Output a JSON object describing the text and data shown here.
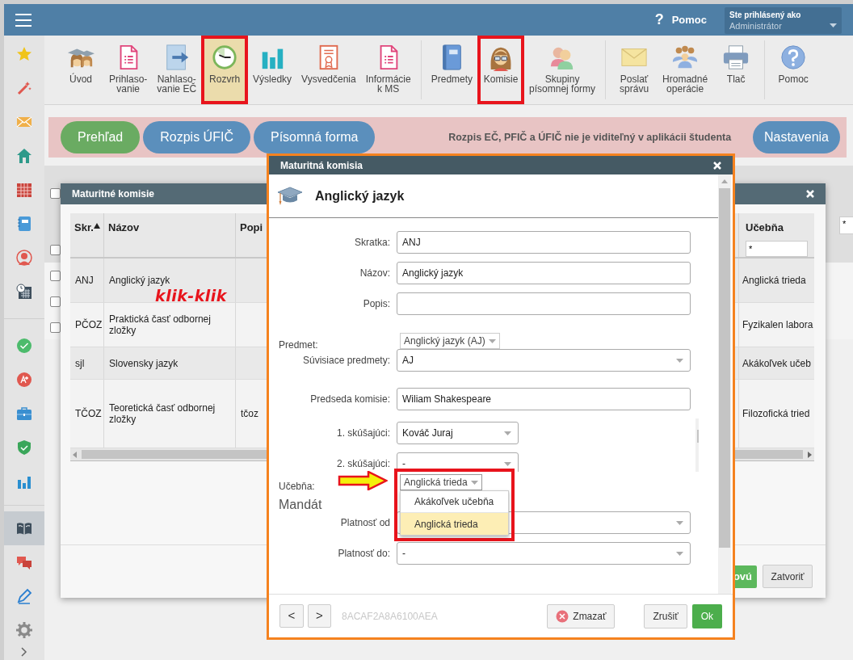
{
  "top_bar": {
    "help_mark": "?",
    "help_label": "Pomoc",
    "user": {
      "caption": "Ste prihlásený ako",
      "name": "Administrátor"
    }
  },
  "sidebar": {
    "groups": [
      [
        {
          "selected": false
        },
        {
          "selected": false
        },
        {
          "selected": false
        },
        {
          "selected": false
        },
        {
          "selected": false
        },
        {
          "selected": false
        },
        {
          "selected": false
        },
        {
          "selected": false
        }
      ],
      [
        {
          "selected": false
        },
        {
          "selected": false
        },
        {
          "selected": false
        },
        {
          "selected": false
        },
        {
          "selected": false
        }
      ],
      [
        {
          "selected": true
        },
        {
          "selected": false
        },
        {
          "selected": false
        },
        {
          "selected": false
        }
      ]
    ]
  },
  "toolbar": {
    "groups": [
      [
        {
          "label": "Úvod",
          "selected": false,
          "highlighted": false
        },
        {
          "label": "Prihlaso-\nvanie",
          "selected": false,
          "highlighted": false
        },
        {
          "label": "Nahlaso-\nvanie EČ",
          "selected": false,
          "highlighted": false
        },
        {
          "label": "Rozvrh",
          "selected": true,
          "highlighted": true
        },
        {
          "label": "Výsledky",
          "selected": false,
          "highlighted": false
        },
        {
          "label": "Vysvedčenia",
          "selected": false,
          "highlighted": false
        },
        {
          "label": "Informácie\nk MS",
          "selected": false,
          "highlighted": false
        }
      ],
      [
        {
          "label": "Predmety",
          "selected": false,
          "highlighted": false
        },
        {
          "label": "Komisie",
          "selected": false,
          "highlighted": true
        },
        {
          "label": "Skupiny\npísomnej formy",
          "selected": false,
          "highlighted": false
        }
      ],
      [
        {
          "label": "Poslať\nsprávu",
          "selected": false,
          "highlighted": false
        },
        {
          "label": "Hromadné\noperácie",
          "selected": false,
          "highlighted": false
        },
        {
          "label": "Tlač",
          "selected": false,
          "highlighted": false
        }
      ],
      [
        {
          "label": "Pomoc",
          "selected": false,
          "highlighted": false
        }
      ]
    ]
  },
  "tab_bar": {
    "tabs": [
      {
        "label": "Prehľad",
        "selected": true
      },
      {
        "label": "Rozpis ÚFIČ",
        "selected": false
      },
      {
        "label": "Písomná forma",
        "selected": false
      }
    ],
    "note": "Rozpis EČ, PFIČ a ÚFIČ nie je viditeľný v aplikácii študenta",
    "settings_button": "Nastavenia"
  },
  "background_table": {
    "checkboxes": [
      {
        "checked": false
      },
      {
        "checked": false
      },
      {
        "checked": false
      },
      {
        "checked": false
      },
      {
        "checked": false
      }
    ],
    "filter_value": "*"
  },
  "commissions_window": {
    "title": "Maturitné komisie",
    "columns": [
      {
        "label": "Skr.",
        "sorted": true
      },
      {
        "label": "Názov"
      },
      {
        "label": "Popi"
      }
    ],
    "right_column": {
      "label": "Učebňa",
      "filter_value": "*"
    },
    "rows": [
      {
        "code": "ANJ",
        "name": "Anglický jazyk",
        "classroom": "Anglická trieda"
      },
      {
        "code": "PČOZ",
        "name": "Praktická časť odbornej zložky",
        "classroom": "Fyzikalen labora"
      },
      {
        "code": "sjl",
        "name": "Slovensky jazyk",
        "classroom": "Akákoľvek učeb"
      },
      {
        "code": "TČOZ",
        "name": "Teoretická časť odbornej zložky",
        "description": "tčoz",
        "classroom": "Filozofická tried"
      }
    ],
    "annotation": "klik-klik",
    "buttons": {
      "new": "ovú",
      "close": "Zatvoriť"
    }
  },
  "dialog": {
    "title": "Maturitná komisia",
    "heading": "Anglický jazyk",
    "fields": [
      {
        "kind": "input",
        "label": "Skratka:",
        "value": "ANJ"
      },
      {
        "kind": "input",
        "label": "Názov:",
        "value": "Anglický jazyk"
      },
      {
        "kind": "input",
        "label": "Popis:"
      },
      {
        "kind": "inline_select",
        "label": "Predmet:",
        "value": "Anglický jazyk (AJ)"
      },
      {
        "kind": "select",
        "label": "Súvisiace predmety:",
        "value": "AJ"
      },
      {
        "kind": "input",
        "label": "Predseda komisie:",
        "value": "Wiliam Shakespeare"
      },
      {
        "kind": "examiners",
        "items": [
          {
            "label": "1. skúšajúci:",
            "value": "Kováč Juraj"
          },
          {
            "label": "2. skúšajúci:",
            "value": "-"
          }
        ]
      },
      {
        "kind": "inline_select",
        "label": "Učebňa:",
        "value": "Anglická trieda",
        "open": true,
        "highlighted": true,
        "options": [
          {
            "label": "Akákoľvek učebňa",
            "selected": false
          },
          {
            "label": "Anglická trieda",
            "selected": true
          }
        ]
      },
      {
        "kind": "heading",
        "label": "Mandát"
      },
      {
        "kind": "select",
        "label": "Platnosť od"
      },
      {
        "kind": "select",
        "label": "Platnosť do:",
        "value": "-"
      }
    ],
    "footer": {
      "prev": "<",
      "next": ">",
      "record_id": "8ACAF2A8A6100AEA",
      "delete": "Zmazať",
      "cancel": "Zrušiť",
      "ok": "Ok"
    }
  }
}
